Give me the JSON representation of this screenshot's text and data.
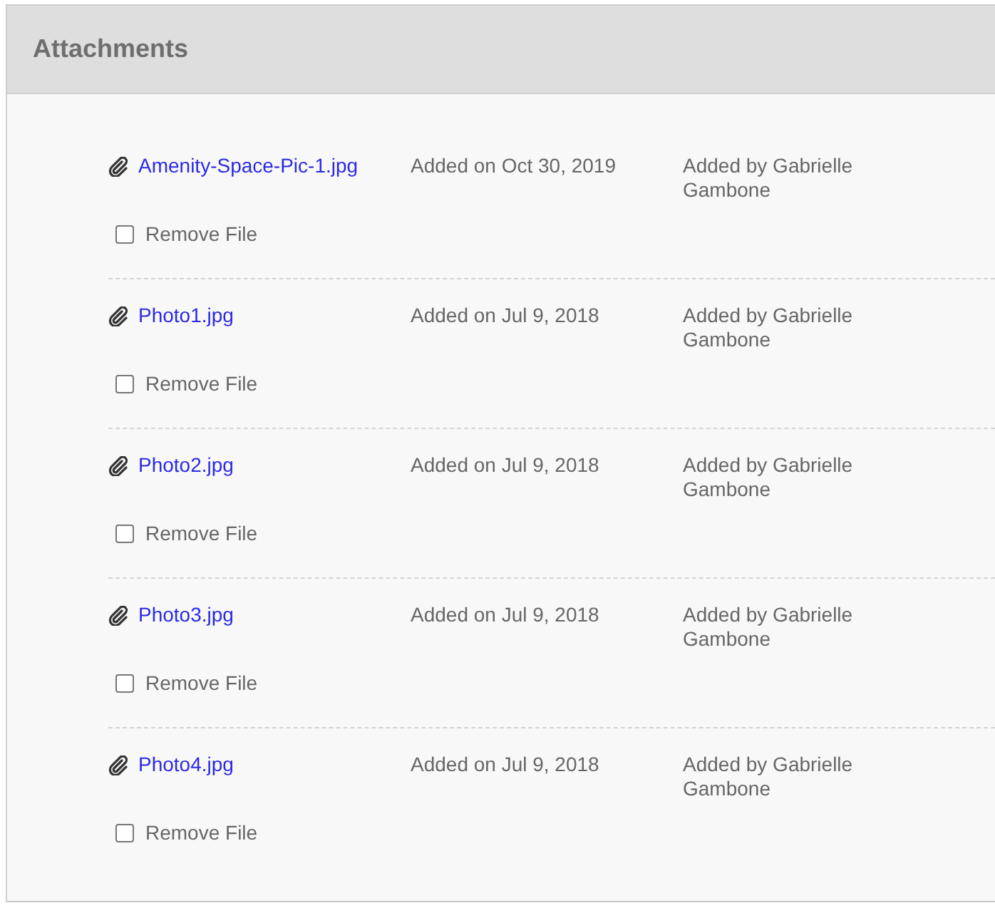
{
  "panel": {
    "title": "Attachments"
  },
  "attachments": [
    {
      "file": "Amenity-Space-Pic-1.jpg",
      "added_on": "Added on Oct 30, 2019",
      "added_by": "Added by Gabrielle Gambone",
      "remove_label": "Remove File",
      "remove_checked": false
    },
    {
      "file": "Photo1.jpg",
      "added_on": "Added on Jul 9, 2018",
      "added_by": "Added by Gabrielle Gambone",
      "remove_label": "Remove File",
      "remove_checked": false
    },
    {
      "file": "Photo2.jpg",
      "added_on": "Added on Jul 9, 2018",
      "added_by": "Added by Gabrielle Gambone",
      "remove_label": "Remove File",
      "remove_checked": false
    },
    {
      "file": "Photo3.jpg",
      "added_on": "Added on Jul 9, 2018",
      "added_by": "Added by Gabrielle Gambone",
      "remove_label": "Remove File",
      "remove_checked": false
    },
    {
      "file": "Photo4.jpg",
      "added_on": "Added on Jul 9, 2018",
      "added_by": "Added by Gabrielle Gambone",
      "remove_label": "Remove File",
      "remove_checked": false
    }
  ]
}
